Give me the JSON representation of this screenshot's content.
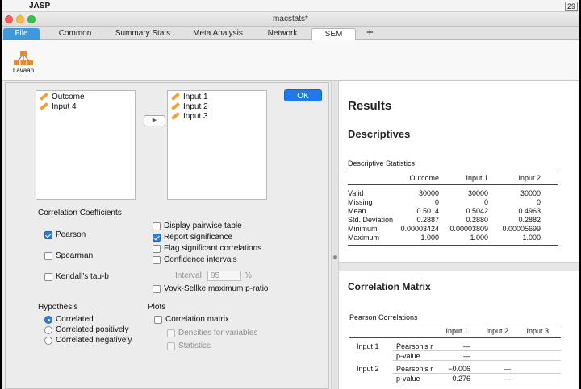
{
  "menubar": {
    "app_name": "JASP",
    "apple_glyph": "",
    "right_badge": "29"
  },
  "window": {
    "title": "macstats*"
  },
  "tabs": [
    "File",
    "Common",
    "Summary Stats",
    "Meta Analysis",
    "Network",
    "SEM"
  ],
  "ribbon": {
    "lavaan_label": "Lavaan"
  },
  "left_vars": [
    "Outcome",
    "Input 4"
  ],
  "right_vars": [
    "Input 1",
    "Input 2",
    "Input 3"
  ],
  "ok_label": "OK",
  "correlation": {
    "title": "Correlation Coefficients",
    "pearson": "Pearson",
    "spearman": "Spearman",
    "kendall": "Kendall's tau-b"
  },
  "options": {
    "pairwise": "Display pairwise table",
    "report_sig": "Report significance",
    "flag_sig": "Flag significant correlations",
    "ci": "Confidence intervals",
    "interval_label": "Interval",
    "interval_value": "95",
    "interval_unit": "%",
    "vovk": "Vovk-Sellke maximum p-ratio"
  },
  "hypothesis": {
    "title": "Hypothesis",
    "correlated": "Correlated",
    "positive": "Correlated positively",
    "negative": "Correlated negatively"
  },
  "plots": {
    "title": "Plots",
    "matrix": "Correlation matrix",
    "densities": "Densities for variables",
    "statistics": "Statistics"
  },
  "results": {
    "title": "Results",
    "descriptives_title": "Descriptives",
    "desc_caption": "Descriptive Statistics",
    "desc_columns": [
      "Outcome",
      "Input 1",
      "Input 2"
    ],
    "desc_rows": [
      {
        "label": "Valid",
        "values": [
          "30000",
          "30000",
          "30000"
        ]
      },
      {
        "label": "Missing",
        "values": [
          "0",
          "0",
          "0"
        ]
      },
      {
        "label": "Mean",
        "values": [
          "0.5014",
          "0.5042",
          "0.4963"
        ]
      },
      {
        "label": "Std. Deviation",
        "values": [
          "0.2887",
          "0.2880",
          "0.2882"
        ]
      },
      {
        "label": "Minimum",
        "values": [
          "0.00003424",
          "0.00003809",
          "0.00005699"
        ]
      },
      {
        "label": "Maximum",
        "values": [
          "1.000",
          "1.000",
          "1.000"
        ]
      }
    ],
    "corr_title": "Correlation Matrix",
    "corr_caption": "Pearson Correlations",
    "corr_columns": [
      "Input 1",
      "Input 2",
      "Input 3"
    ],
    "corr_rows": [
      {
        "var": "Input 1",
        "stat": "Pearson's r",
        "values": [
          "—",
          "",
          ""
        ]
      },
      {
        "var": "",
        "stat": "p-value",
        "values": [
          "—",
          "",
          ""
        ]
      },
      {
        "var": "Input 2",
        "stat": "Pearson's r",
        "values": [
          "−0.006",
          "—",
          ""
        ]
      },
      {
        "var": "",
        "stat": "p-value",
        "values": [
          "0.276",
          "—",
          ""
        ]
      }
    ]
  }
}
